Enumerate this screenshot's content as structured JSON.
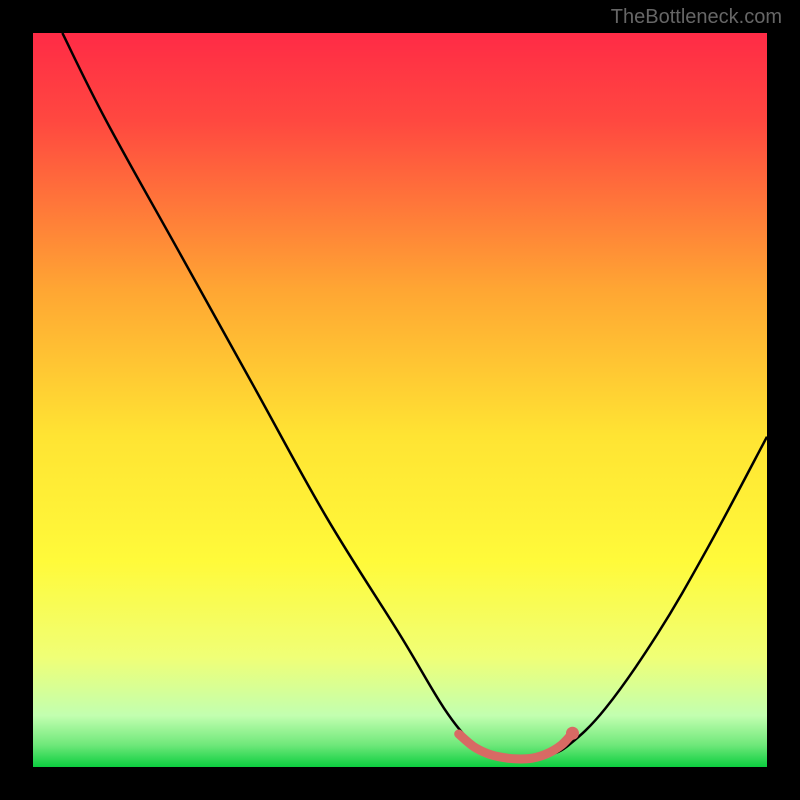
{
  "watermark": "TheBottleneck.com",
  "chart_data": {
    "type": "line",
    "title": "",
    "xlabel": "",
    "ylabel": "",
    "xlim": [
      0,
      100
    ],
    "ylim": [
      0,
      100
    ],
    "gradient_colors": {
      "top": "#ff2b46",
      "mid_upper": "#ffb231",
      "mid": "#fffa3a",
      "lower": "#f6ff8a",
      "bottom": "#0cce3f"
    },
    "curve": {
      "description": "V-shaped bottleneck curve, minimum near x~66",
      "points": [
        [
          4,
          100
        ],
        [
          10,
          88
        ],
        [
          20,
          70
        ],
        [
          30,
          52
        ],
        [
          40,
          34
        ],
        [
          50,
          18
        ],
        [
          56,
          8
        ],
        [
          60,
          3
        ],
        [
          62,
          1.5
        ],
        [
          65,
          1
        ],
        [
          68,
          1
        ],
        [
          70,
          1.5
        ],
        [
          73,
          3
        ],
        [
          78,
          8
        ],
        [
          85,
          18
        ],
        [
          92,
          30
        ],
        [
          100,
          45
        ]
      ]
    },
    "marker_region": {
      "color": "#d86a64",
      "points": [
        [
          58,
          4.5
        ],
        [
          60,
          2.8
        ],
        [
          62,
          1.8
        ],
        [
          64,
          1.3
        ],
        [
          66,
          1.1
        ],
        [
          68,
          1.2
        ],
        [
          70,
          1.8
        ],
        [
          72,
          3.0
        ],
        [
          73.5,
          4.6
        ]
      ],
      "end_dot": [
        73.5,
        4.6
      ]
    }
  }
}
